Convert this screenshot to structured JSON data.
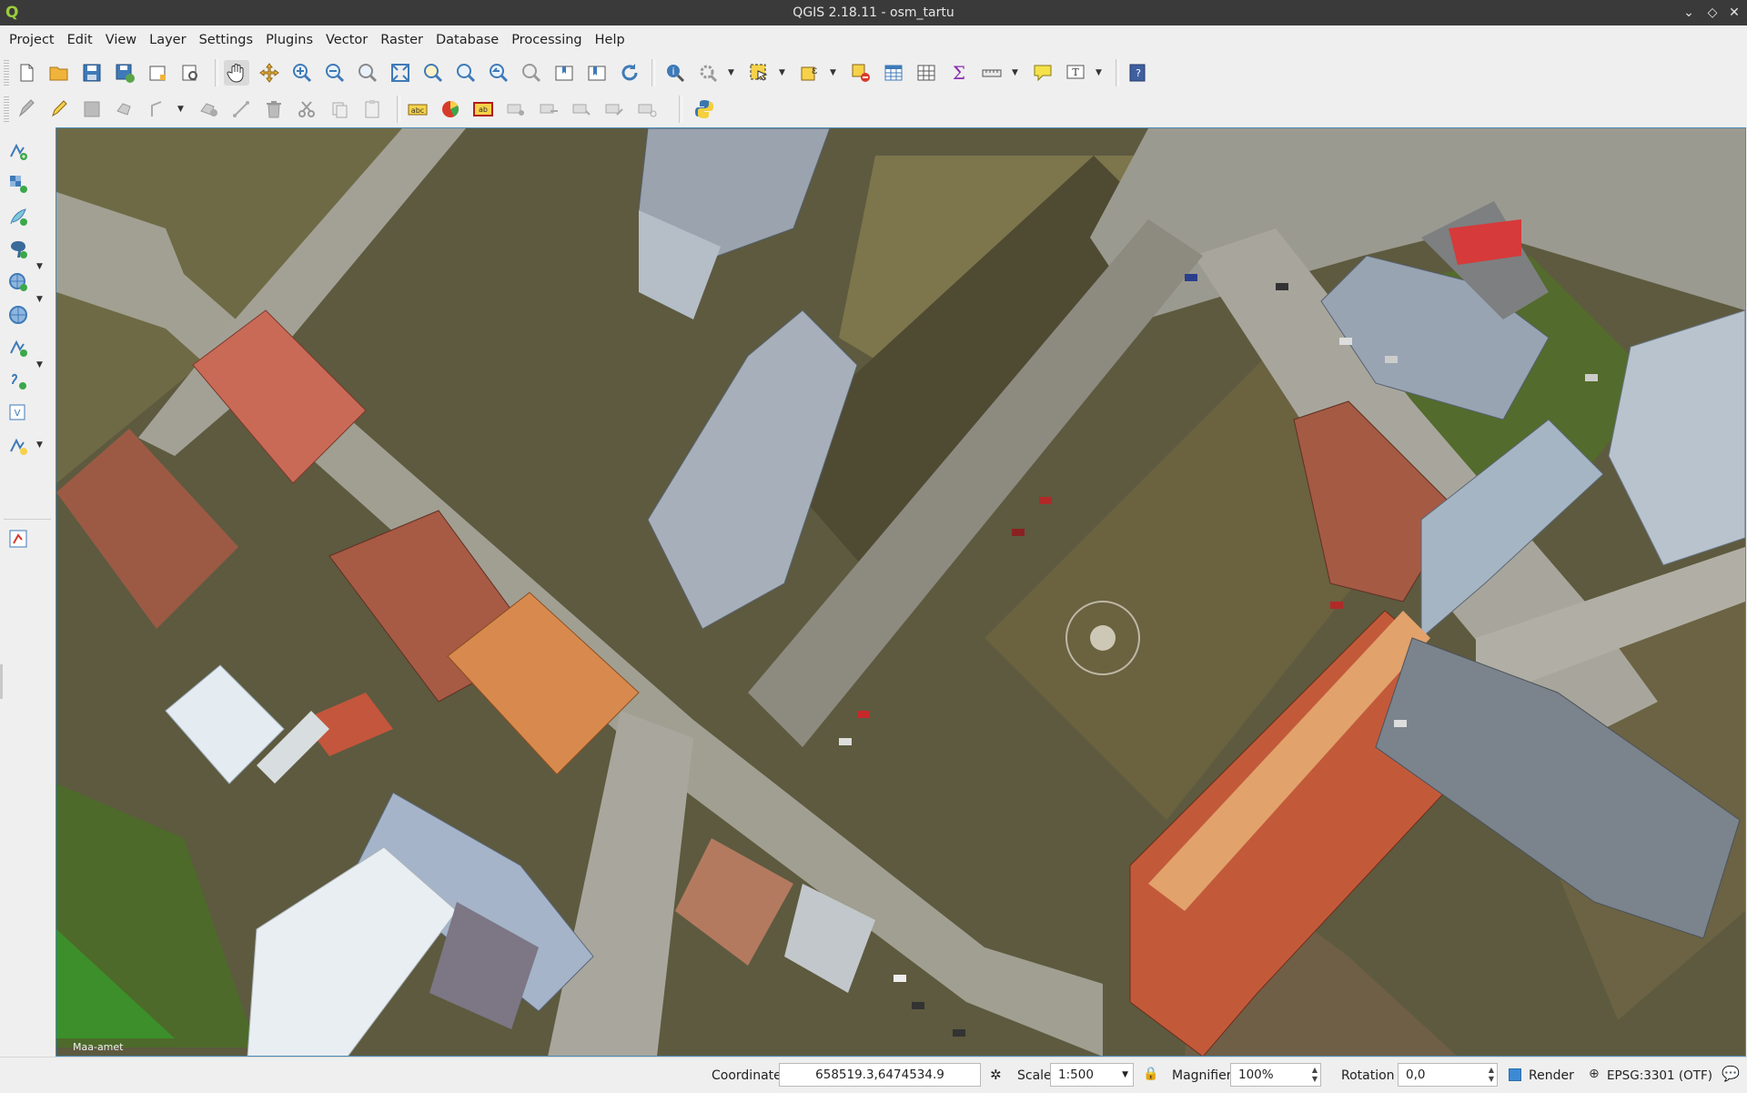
{
  "window": {
    "title": "QGIS 2.18.11 - osm_tartu"
  },
  "menu": [
    "Project",
    "Edit",
    "View",
    "Layer",
    "Settings",
    "Plugins",
    "Vector",
    "Raster",
    "Database",
    "Processing",
    "Help"
  ],
  "map": {
    "credit": "Maa-amet",
    "watermark": "Maa-amet"
  },
  "status": {
    "coordinate_label": "Coordinate",
    "coordinate_value": "658519.3,6474534.9",
    "scale_label": "Scale",
    "scale_value": "1:500",
    "magnifier_label": "Magnifier",
    "magnifier_value": "100%",
    "rotation_label": "Rotation",
    "rotation_value": "0,0",
    "render_label": "Render",
    "render_checked": true,
    "crs": "EPSG:3301 (OTF)"
  },
  "icons": {
    "toolbar1": [
      "new-project-icon",
      "open-project-icon",
      "save-project-icon",
      "save-as-icon",
      "new-print-composer-icon",
      "composer-manager-icon",
      "pan-icon",
      "pan-to-selection-icon",
      "zoom-in-icon",
      "zoom-out-icon",
      "zoom-native-icon",
      "zoom-full-icon",
      "zoom-to-selection-icon",
      "zoom-to-layer-icon",
      "zoom-last-icon",
      "zoom-next-icon",
      "new-bookmark-icon",
      "show-bookmarks-icon",
      "refresh-icon",
      "identify-icon",
      "action-icon",
      "select-features-icon",
      "select-by-expression-icon",
      "deselect-icon",
      "attribute-table-icon",
      "field-calculator-icon",
      "statistics-icon",
      "measure-icon",
      "map-tips-icon",
      "text-annotation-icon",
      "help-icon"
    ],
    "toolbar2": [
      "toggle-editing-icon",
      "current-edits-icon",
      "save-edits-icon",
      "add-feature-icon",
      "move-feature-icon",
      "node-tool-icon",
      "delete-selected-icon",
      "cut-features-icon",
      "copy-features-icon",
      "paste-features-icon",
      "label-icon",
      "diagram-icon",
      "pin-labels-icon",
      "show-hide-labels-icon",
      "move-label-icon",
      "rotate-label-icon",
      "change-label-icon",
      "python-console-icon"
    ],
    "sidebar": [
      "add-vector-layer-icon",
      "add-raster-layer-icon",
      "add-spatialite-layer-icon",
      "add-postgis-layer-icon",
      "add-wms-layer-icon",
      "add-wcs-layer-icon",
      "add-wfs-layer-icon",
      "add-delimited-text-icon",
      "add-virtual-layer-icon",
      "new-shapefile-icon",
      "processing-toolbox-icon"
    ]
  },
  "colors": {
    "accent": "#4a8ab4",
    "titlebar": "#3a3a3a",
    "panel": "#efefef"
  }
}
